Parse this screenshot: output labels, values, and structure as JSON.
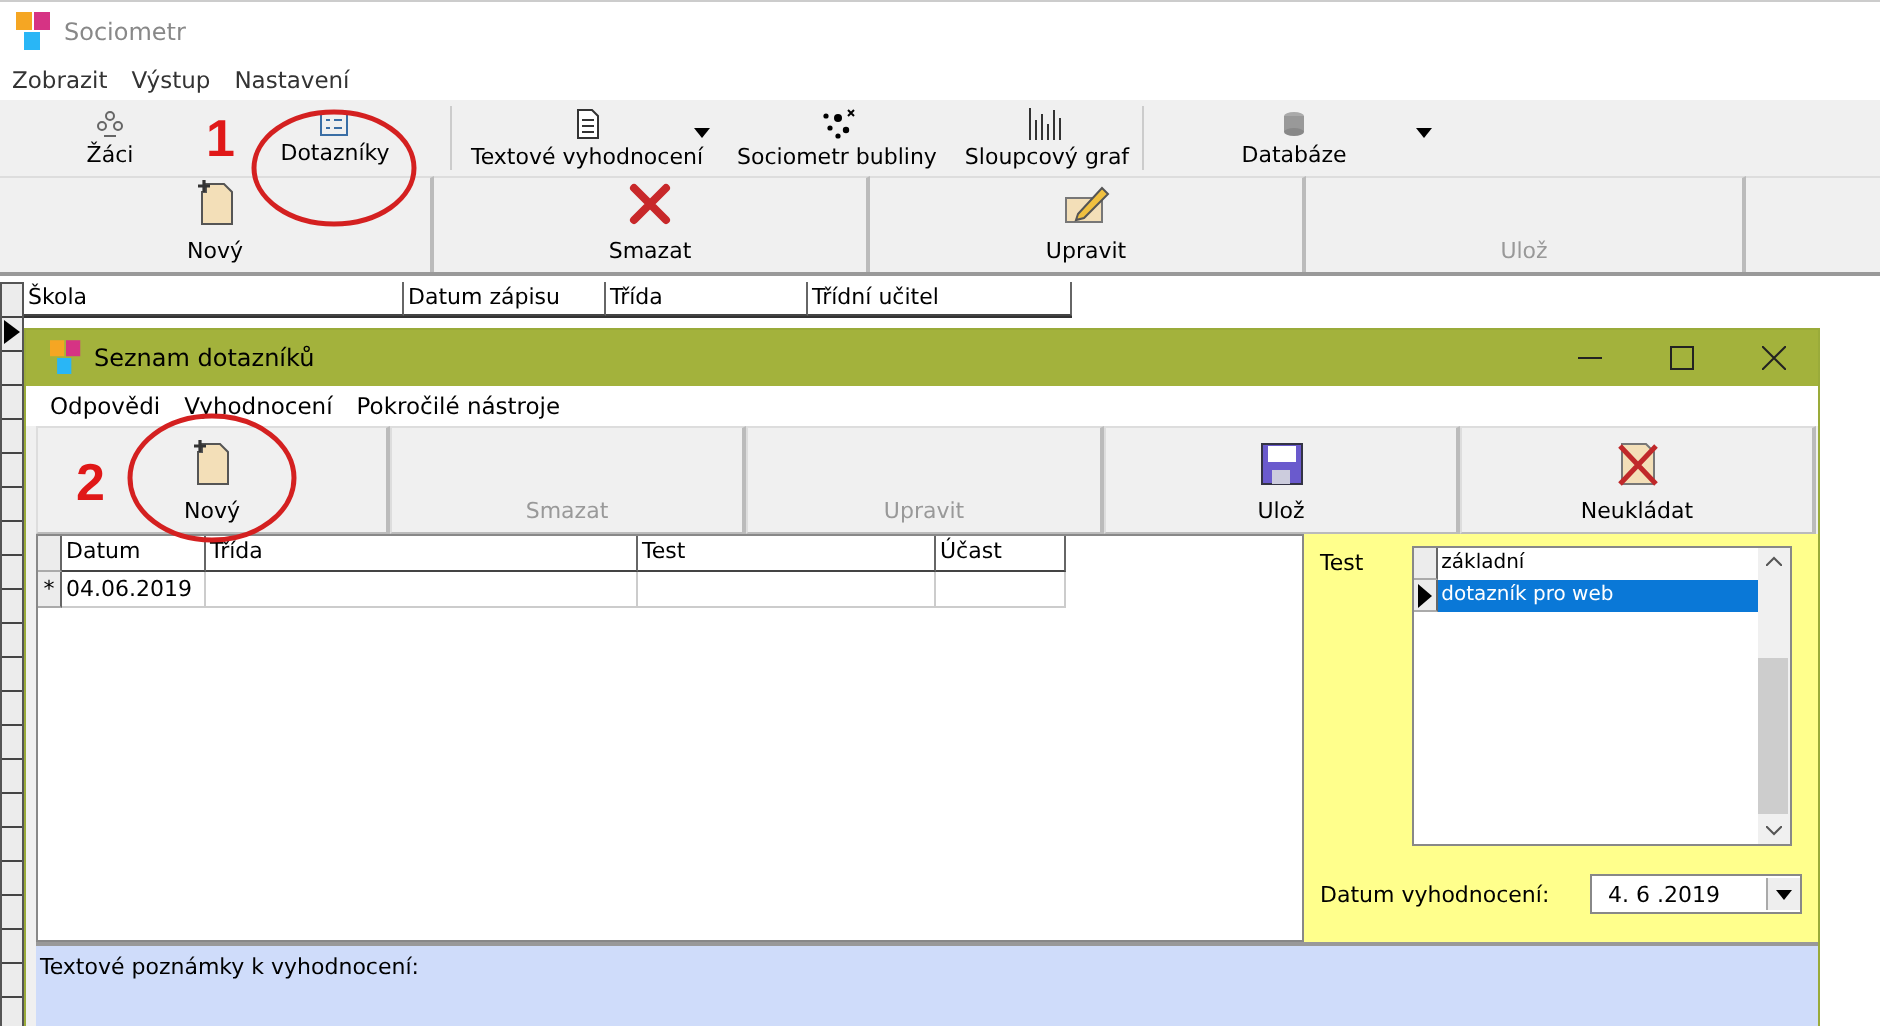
{
  "window": {
    "title": "Sociometr"
  },
  "menu": [
    "Zobrazit",
    "Výstup",
    "Nastavení"
  ],
  "toolbar": [
    {
      "label": "Žáci",
      "kind": "people"
    },
    {
      "label": "Dotazníky",
      "kind": "form"
    },
    {
      "label": "Textové vyhodnocení",
      "kind": "document",
      "dropdown": true
    },
    {
      "label": "Sociometr bubliny",
      "kind": "bubbles"
    },
    {
      "label": "Sloupcový graf",
      "kind": "bars",
      "separator_after": true
    },
    {
      "label": "Databáze",
      "kind": "database",
      "dropdown": true
    }
  ],
  "actions": [
    {
      "label": "Nový",
      "kind": "new",
      "disabled": false
    },
    {
      "label": "Smazat",
      "kind": "delete",
      "disabled": false
    },
    {
      "label": "Upravit",
      "kind": "edit",
      "disabled": false
    },
    {
      "label": "Ulož",
      "kind": "save",
      "disabled": true
    }
  ],
  "grid": {
    "columns": [
      "Škola",
      "Datum zápisu",
      "Třída",
      "Třídní učitel"
    ]
  },
  "annotations": [
    {
      "label": "1"
    },
    {
      "label": "2"
    }
  ],
  "dialog": {
    "title": "Seznam dotazníků",
    "menu": [
      "Odpovědi",
      "Vyhodnocení",
      "Pokročilé nástroje"
    ],
    "actions": [
      {
        "label": "Nový",
        "kind": "new",
        "disabled": false
      },
      {
        "label": "Smazat",
        "kind": "delete",
        "disabled": true
      },
      {
        "label": "Upravit",
        "kind": "edit",
        "disabled": true
      },
      {
        "label": "Ulož",
        "kind": "save",
        "disabled": false
      },
      {
        "label": "Neukládat",
        "kind": "discard",
        "disabled": false
      }
    ],
    "grid": {
      "columns": [
        "Datum",
        "Třída",
        "Test",
        "Účast"
      ],
      "rows": [
        {
          "marker": "*",
          "cells": [
            "04.06.2019",
            "",
            "",
            ""
          ]
        }
      ]
    },
    "test_panel": {
      "label": "Test",
      "items": [
        {
          "label": "základní",
          "selected": false
        },
        {
          "label": "dotazník pro web",
          "selected": true
        }
      ],
      "date_label": "Datum vyhodnocení:",
      "date_value": "4. 6 .2019"
    },
    "notes_label": "Textové poznámky k vyhodnocení:"
  }
}
